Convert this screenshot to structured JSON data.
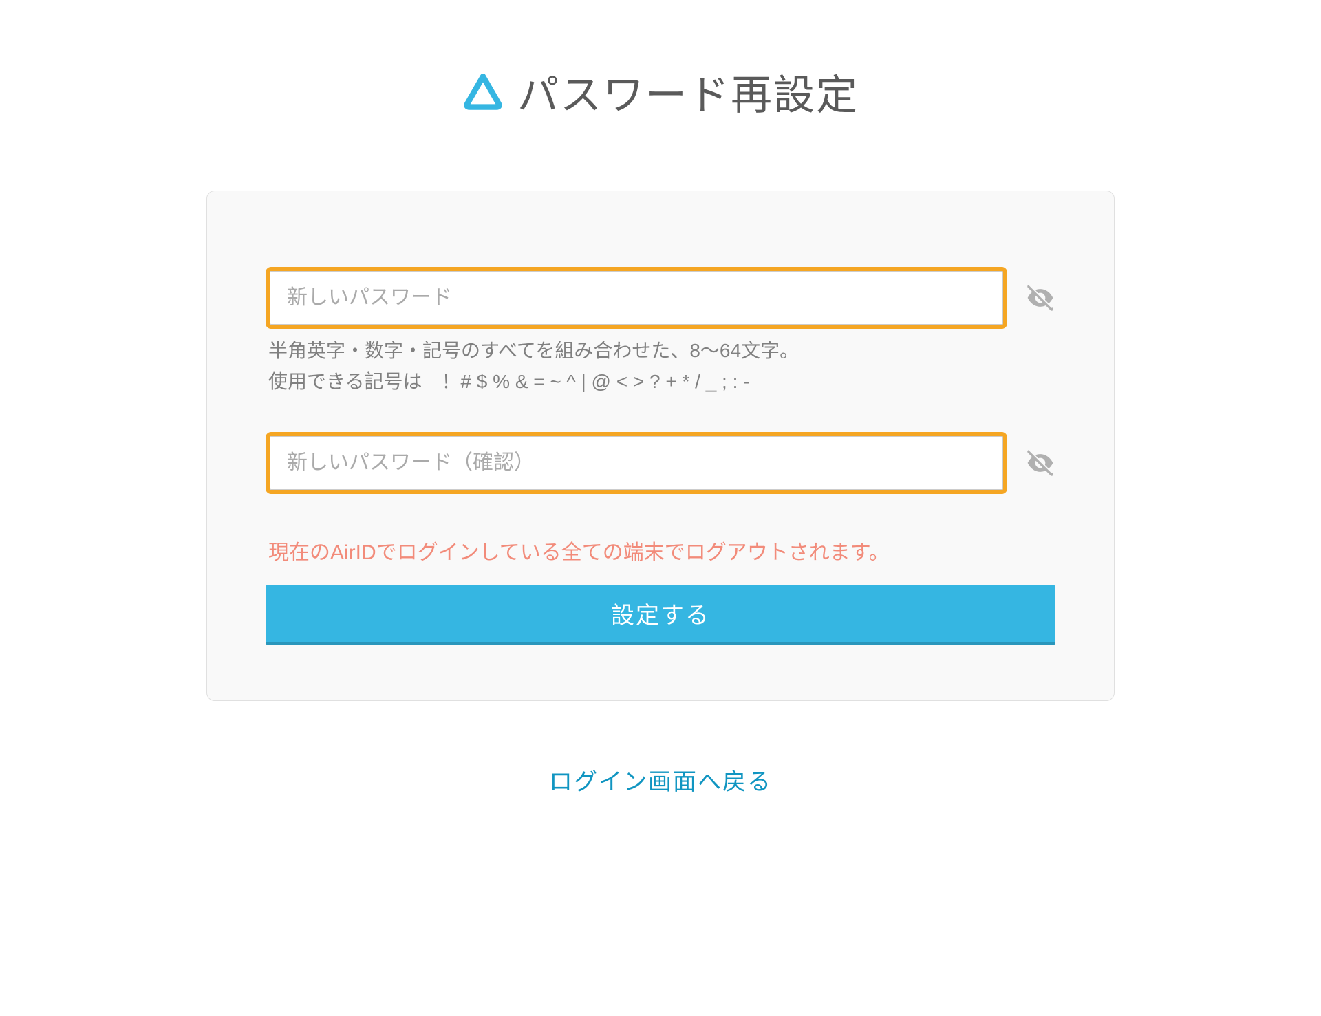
{
  "header": {
    "title": "パスワード再設定"
  },
  "form": {
    "password": {
      "placeholder": "新しいパスワード",
      "value": ""
    },
    "helper_line1": "半角英字・数字・記号のすべてを組み合わせた、8〜64文字。",
    "helper_line2": "使用できる記号は　！# $ % & = ~ ^ | @ < > ? + * / _ ; : -",
    "password_confirm": {
      "placeholder": "新しいパスワード（確認）",
      "value": ""
    },
    "warning": "現在のAirIDでログインしている全ての端末でログアウトされます。",
    "submit_label": "設定する"
  },
  "footer": {
    "back_link": "ログイン画面へ戻る"
  },
  "colors": {
    "accent": "#35b6e2",
    "highlight": "#f5a623",
    "warning": "#f28b7a"
  }
}
